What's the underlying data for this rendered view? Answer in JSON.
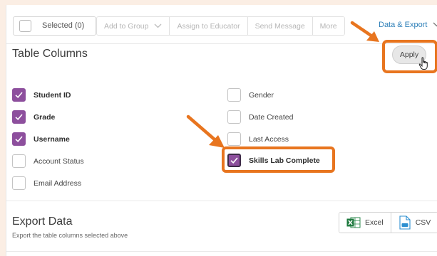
{
  "toolbar": {
    "selected_label": "Selected (0)",
    "buttons": [
      {
        "label": "Add to Group",
        "has_chevron": true
      },
      {
        "label": "Assign to Educator"
      },
      {
        "label": "Send Message"
      },
      {
        "label": "More"
      }
    ],
    "data_export_label": "Data & Export"
  },
  "table_columns": {
    "title": "Table Columns",
    "apply_label": "Apply",
    "left_items": [
      {
        "label": "Student ID",
        "checked": true
      },
      {
        "label": "Grade",
        "checked": true
      },
      {
        "label": "Username",
        "checked": true
      },
      {
        "label": "Account Status",
        "checked": false
      },
      {
        "label": "Email Address",
        "checked": false
      }
    ],
    "right_items": [
      {
        "label": "Gender",
        "checked": false
      },
      {
        "label": "Date Created",
        "checked": false
      },
      {
        "label": "Last Access",
        "checked": false
      },
      {
        "label": "Skills Lab Complete",
        "checked": true
      }
    ]
  },
  "export_data": {
    "title": "Export Data",
    "subtitle": "Export the table columns selected above",
    "excel_label": "Excel",
    "csv_label": "CSV"
  },
  "colors": {
    "accent_purple": "#8d4f9d",
    "highlight_orange": "#e8751f",
    "link_blue": "#2d7fb8",
    "page_bg": "#fbeee4"
  }
}
